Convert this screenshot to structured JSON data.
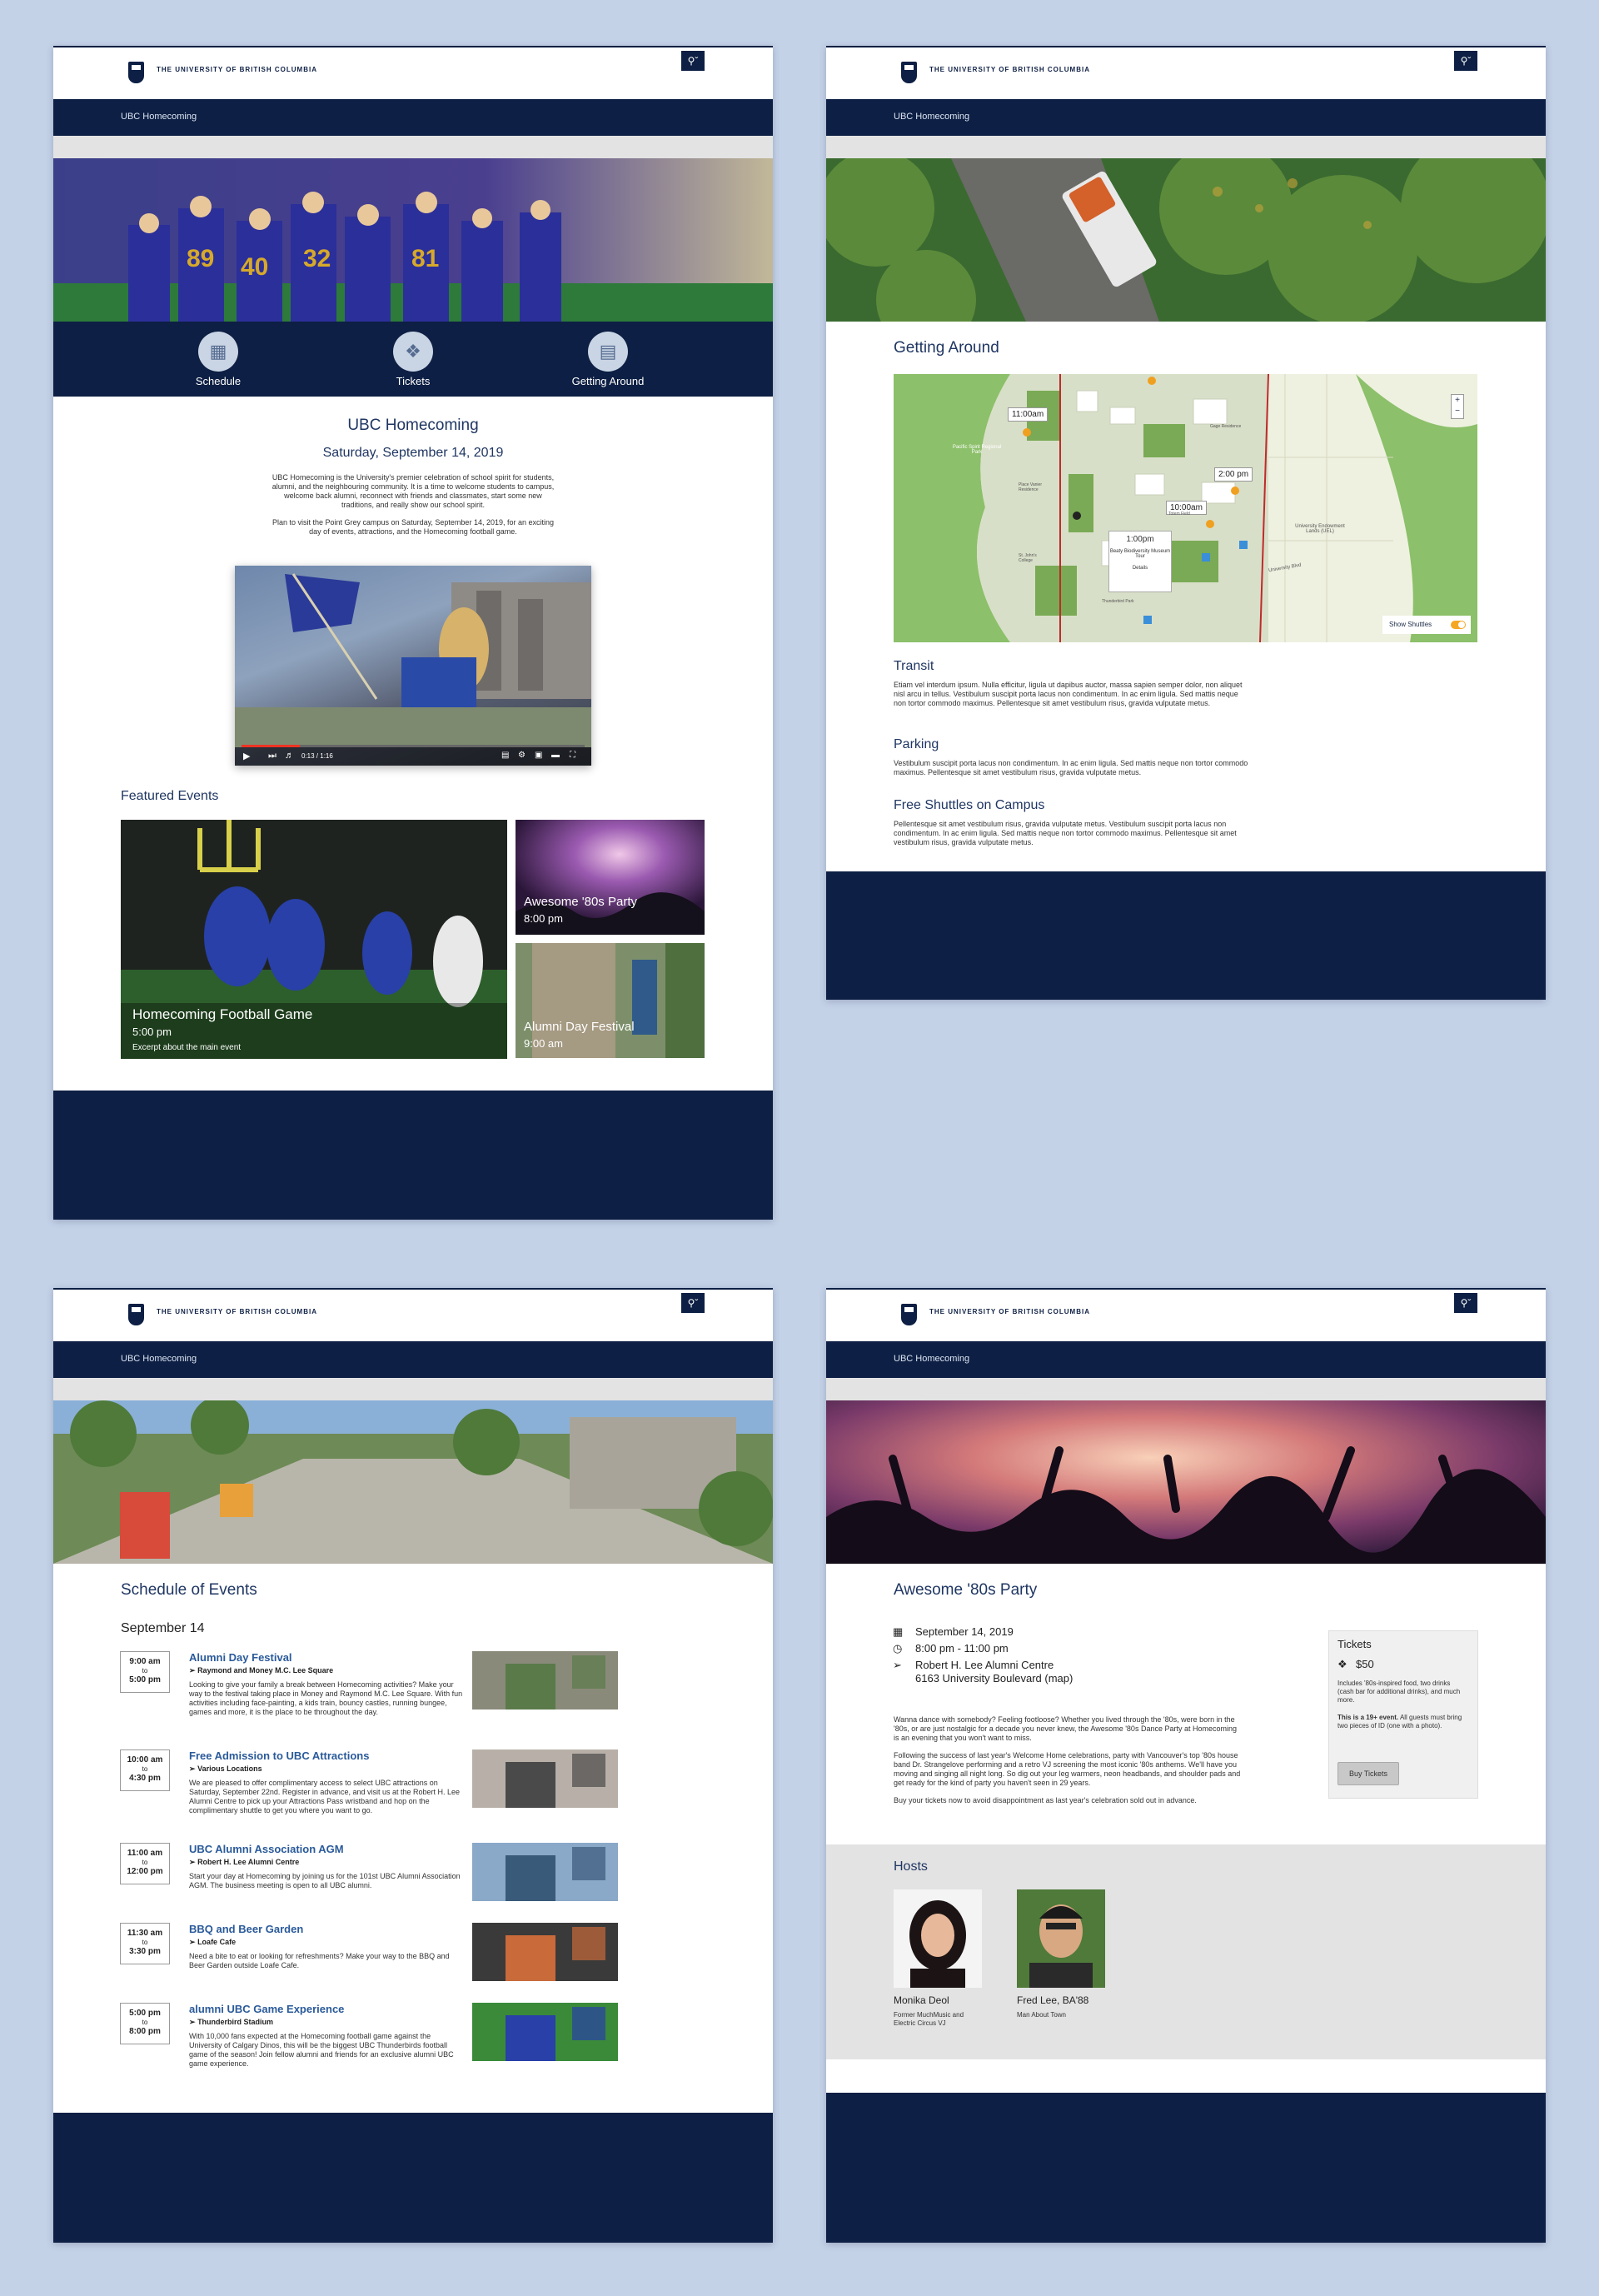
{
  "university": "THE UNIVERSITY OF BRITISH COLUMBIA",
  "site_title": "UBC Homecoming",
  "colors": {
    "navy": "#0d1f44",
    "accent_link": "#2a5a9a",
    "background": "#c4d2e8",
    "toggle": "#f5a623"
  },
  "home": {
    "nav": [
      {
        "label": "Schedule",
        "icon": "calendar-icon"
      },
      {
        "label": "Tickets",
        "icon": "ticket-icon"
      },
      {
        "label": "Getting Around",
        "icon": "map-book-icon"
      }
    ],
    "title": "UBC Homecoming",
    "date": "Saturday, September 14, 2019",
    "intro1": "UBC Homecoming is the University's premier celebration of school spirit for students, alumni, and the neighbouring community. It is a time to welcome students to campus, welcome back alumni, reconnect with friends and classmates, start some new traditions, and really show our school spirit.",
    "intro2": "Plan to visit the Point Grey campus on Saturday, September 14, 2019, for an exciting day of events, attractions, and the Homecoming football game.",
    "video_time": "0:13 / 1:16",
    "video_progress": 0.17,
    "featured_heading": "Featured Events",
    "featured": [
      {
        "title": "Homecoming Football Game",
        "time": "5:00 pm",
        "excerpt": "Excerpt about the main event"
      },
      {
        "title": "Awesome '80s Party",
        "time": "8:00 pm"
      },
      {
        "title": "Alumni Day Festival",
        "time": "9:00 am"
      }
    ]
  },
  "getting_around": {
    "title": "Getting Around",
    "map_labels": [
      "11:00am",
      "2:00 pm",
      "10:00am",
      "1:00pm",
      "Beaty Biodiversity Museum Tour",
      "Details",
      "Pacific Spirit Regional Park",
      "University Endowment Lands (UEL)",
      "University Blvd",
      "Totem Field",
      "Thunderbird Park",
      "Gage Residence",
      "Place Vanier Residence",
      "St. John's College"
    ],
    "zoom_in": "+",
    "zoom_out": "−",
    "show_shuttles": "Show Shuttles",
    "show_shuttles_on": true,
    "transit_title": "Transit",
    "transit_text": "Etiam vel interdum ipsum. Nulla efficitur, ligula ut dapibus auctor, massa sapien semper dolor, non aliquet nisl arcu in tellus. Vestibulum suscipit porta lacus non condimentum. In ac enim ligula. Sed mattis neque non tortor commodo maximus. Pellentesque sit amet vestibulum risus, gravida vulputate metus.",
    "parking_title": "Parking",
    "parking_text": "Vestibulum suscipit porta lacus non condimentum. In ac enim ligula. Sed mattis neque non tortor commodo maximus. Pellentesque sit amet vestibulum risus, gravida vulputate metus.",
    "shuttle_title": "Free Shuttles on Campus",
    "shuttle_text": "Pellentesque sit amet vestibulum risus, gravida vulputate metus. Vestibulum suscipit porta lacus non condimentum. In ac enim ligula. Sed mattis neque non tortor commodo maximus. Pellentesque sit amet vestibulum risus, gravida vulputate metus."
  },
  "schedule": {
    "title": "Schedule  of Events",
    "day": "September 14",
    "events": [
      {
        "start": "9:00 am",
        "to": "to",
        "end": "5:00 pm",
        "title": "Alumni Day Festival",
        "location": "Raymond and Money M.C. Lee Square",
        "desc": "Looking to give your family a break between Homecoming activities? Make your way to the festival taking place in Money and Raymond M.C. Lee Square. With fun activities including face-painting, a kids train, bouncy castles, running bungee, games and more, it is the place to be throughout the day."
      },
      {
        "start": "10:00 am",
        "to": "to",
        "end": "4:30 pm",
        "title": "Free Admission to UBC Attractions",
        "location": "Various Locations",
        "desc": "We are pleased to offer complimentary access to select UBC attractions on Saturday, September 22nd. Register in advance, and visit us at the Robert H. Lee Alumni Centre to pick up your Attractions Pass wristband and hop on the complimentary shuttle to get you where you want to go."
      },
      {
        "start": "11:00 am",
        "to": "to",
        "end": "12:00 pm",
        "title": "UBC Alumni Association AGM",
        "location": "Robert H. Lee Alumni Centre",
        "desc": "Start your day at Homecoming by joining us for the 101st UBC Alumni Association AGM. The business meeting is open to all UBC alumni."
      },
      {
        "start": "11:30 am",
        "to": "to",
        "end": "3:30 pm",
        "title": "BBQ and Beer Garden",
        "location": "Loafe Cafe",
        "desc": "Need a bite to eat or looking for refreshments? Make your way to the BBQ and Beer Garden outside Loafe Cafe."
      },
      {
        "start": "5:00 pm",
        "to": "to",
        "end": "8:00 pm",
        "title": "alumni UBC Game Experience",
        "location": "Thunderbird Stadium",
        "desc": "With 10,000 fans expected at the Homecoming football game against the University of Calgary Dinos, this will be the biggest UBC Thunderbirds football game of the season! Join fellow alumni and friends for an exclusive alumni UBC game experience."
      }
    ]
  },
  "party": {
    "title": "Awesome '80s Party",
    "date": "September 14, 2019",
    "time": "8:00 pm - 11:00 pm",
    "venue": "Robert H. Lee Alumni Centre",
    "address": "6163 University Boulevard",
    "map_link": "(map)",
    "desc1": "Wanna dance with somebody? Feeling footloose? Whether you lived through the '80s, were born in the '80s, or are just nostalgic for a decade you never knew, the Awesome '80s Dance Party at Homecoming is an evening that you won't want to miss.",
    "desc2": "Following the success of last year's Welcome Home celebrations, party with Vancouver's top '80s house band Dr. Strangelove performing and a retro VJ screening the most iconic '80s anthems. We'll have you moving and singing all night long. So dig out your leg warmers, neon headbands, and shoulder pads and get ready for the kind of party you haven't seen in 29 years.",
    "desc3": "Buy your tickets now to avoid disappointment as last year's celebration sold out in advance.",
    "tickets_heading": "Tickets",
    "price": "$50",
    "tickets_note": "Includes '80s-inspired food, two drinks (cash bar for additional drinks), and much more.",
    "tickets_warning_bold": "This is a 19+ event.",
    "tickets_warning": "All guests must bring two pieces of ID (one with a photo).",
    "buy_label": "Buy Tickets",
    "hosts_heading": "Hosts",
    "hosts": [
      {
        "name": "Monika Deol",
        "role": "Former MuchMusic and Electric Circus VJ"
      },
      {
        "name": "Fred Lee, BA'88",
        "role": "Man About Town"
      }
    ]
  }
}
